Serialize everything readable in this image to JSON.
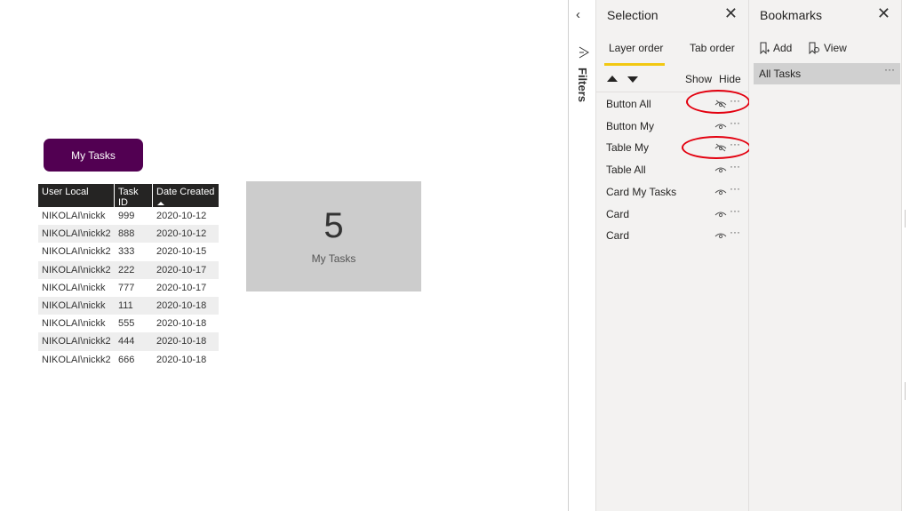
{
  "canvas": {
    "button_label": "My Tasks",
    "button_color": "#520052",
    "table": {
      "columns": [
        "User Local",
        "Task ID",
        "Date Created"
      ],
      "sorted_column": "Date Created",
      "rows": [
        [
          "NIKOLAI\\nickk",
          "999",
          "2020-10-12"
        ],
        [
          "NIKOLAI\\nickk2",
          "888",
          "2020-10-12"
        ],
        [
          "NIKOLAI\\nickk2",
          "333",
          "2020-10-15"
        ],
        [
          "NIKOLAI\\nickk2",
          "222",
          "2020-10-17"
        ],
        [
          "NIKOLAI\\nickk",
          "777",
          "2020-10-17"
        ],
        [
          "NIKOLAI\\nickk",
          "111",
          "2020-10-18"
        ],
        [
          "NIKOLAI\\nickk",
          "555",
          "2020-10-18"
        ],
        [
          "NIKOLAI\\nickk2",
          "444",
          "2020-10-18"
        ],
        [
          "NIKOLAI\\nickk2",
          "666",
          "2020-10-18"
        ]
      ]
    },
    "card": {
      "value": "5",
      "label": "My Tasks"
    }
  },
  "filters": {
    "label": "Filters",
    "collapse_icon": "chevron-left-icon"
  },
  "selection": {
    "title": "Selection",
    "tabs": [
      "Layer order",
      "Tab order"
    ],
    "active_tab": "Layer order",
    "show_label": "Show",
    "hide_label": "Hide",
    "layers": [
      {
        "label": "Button All",
        "hidden": true
      },
      {
        "label": "Button My",
        "hidden": false
      },
      {
        "label": "Table My",
        "hidden": true
      },
      {
        "label": "Table All",
        "hidden": false
      },
      {
        "label": "Card My Tasks",
        "hidden": false
      },
      {
        "label": "Card",
        "hidden": false
      },
      {
        "label": "Card",
        "hidden": false
      }
    ],
    "more_glyph": "···",
    "accent": "#f2c811",
    "highlight_color": "#e3000f"
  },
  "bookmarks": {
    "title": "Bookmarks",
    "add_label": "Add",
    "view_label": "View",
    "items": [
      {
        "label": "All Tasks"
      }
    ],
    "more_glyph": "···"
  },
  "close_glyph": "✕",
  "back_glyph": "‹"
}
